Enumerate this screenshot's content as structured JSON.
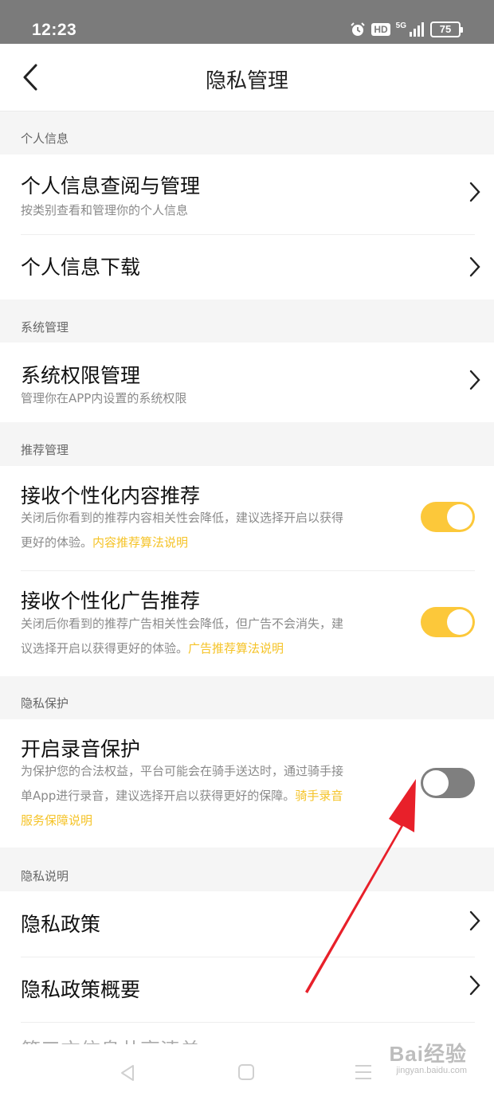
{
  "status_bar": {
    "time": "12:23",
    "hd": "HD",
    "network": "5G",
    "battery": "75",
    "icons": [
      "alarm-icon",
      "signal-icon",
      "battery-icon"
    ]
  },
  "header": {
    "title": "隐私管理",
    "back_icon": "chevron-left-icon"
  },
  "sections": {
    "personal": {
      "header": "个人信息",
      "view": {
        "title": "个人信息查阅与管理",
        "subtitle": "按类别查看和管理你的个人信息"
      },
      "download": {
        "title": "个人信息下载"
      }
    },
    "system": {
      "header": "系统管理",
      "permissions": {
        "title": "系统权限管理",
        "subtitle": "管理你在APP内设置的系统权限"
      }
    },
    "recommend": {
      "header": "推荐管理",
      "content": {
        "title": "接收个性化内容推荐",
        "desc_line1": "关闭后你看到的推荐内容相关性会降低，建议选择开启以获得",
        "desc_line2": "更好的体验。",
        "link": "内容推荐算法说明",
        "enabled": true
      },
      "ads": {
        "title": "接收个性化广告推荐",
        "desc_line1": "关闭后你看到的推荐广告相关性会降低，但广告不会消失，建",
        "desc_line2": "议选择开启以获得更好的体验。",
        "link": "广告推荐算法说明",
        "enabled": true
      }
    },
    "protect": {
      "header": "隐私保护",
      "recording": {
        "title": "开启录音保护",
        "desc_line1": "为保护您的合法权益，平台可能会在骑手送达时，通过骑手接",
        "desc_line2": "单App进行录音，建议选择开启以获得更好的保障。",
        "link_part1": "骑手录音",
        "link_part2": "服务保障说明",
        "enabled": false
      }
    },
    "policy": {
      "header": "隐私说明",
      "policy": {
        "title": "隐私政策"
      },
      "summary": {
        "title": "隐私政策概要"
      },
      "next_peek": "第三方信息共享清单"
    }
  },
  "watermark": {
    "brand": "Bai经验",
    "site": "jingyan.baidu.com"
  },
  "colors": {
    "accent": "#fcc83a",
    "link": "#f5c327",
    "toggle_off": "#7f7f7f",
    "annotation_arrow": "#e8202a",
    "status_bar": "#7b7b7b"
  }
}
